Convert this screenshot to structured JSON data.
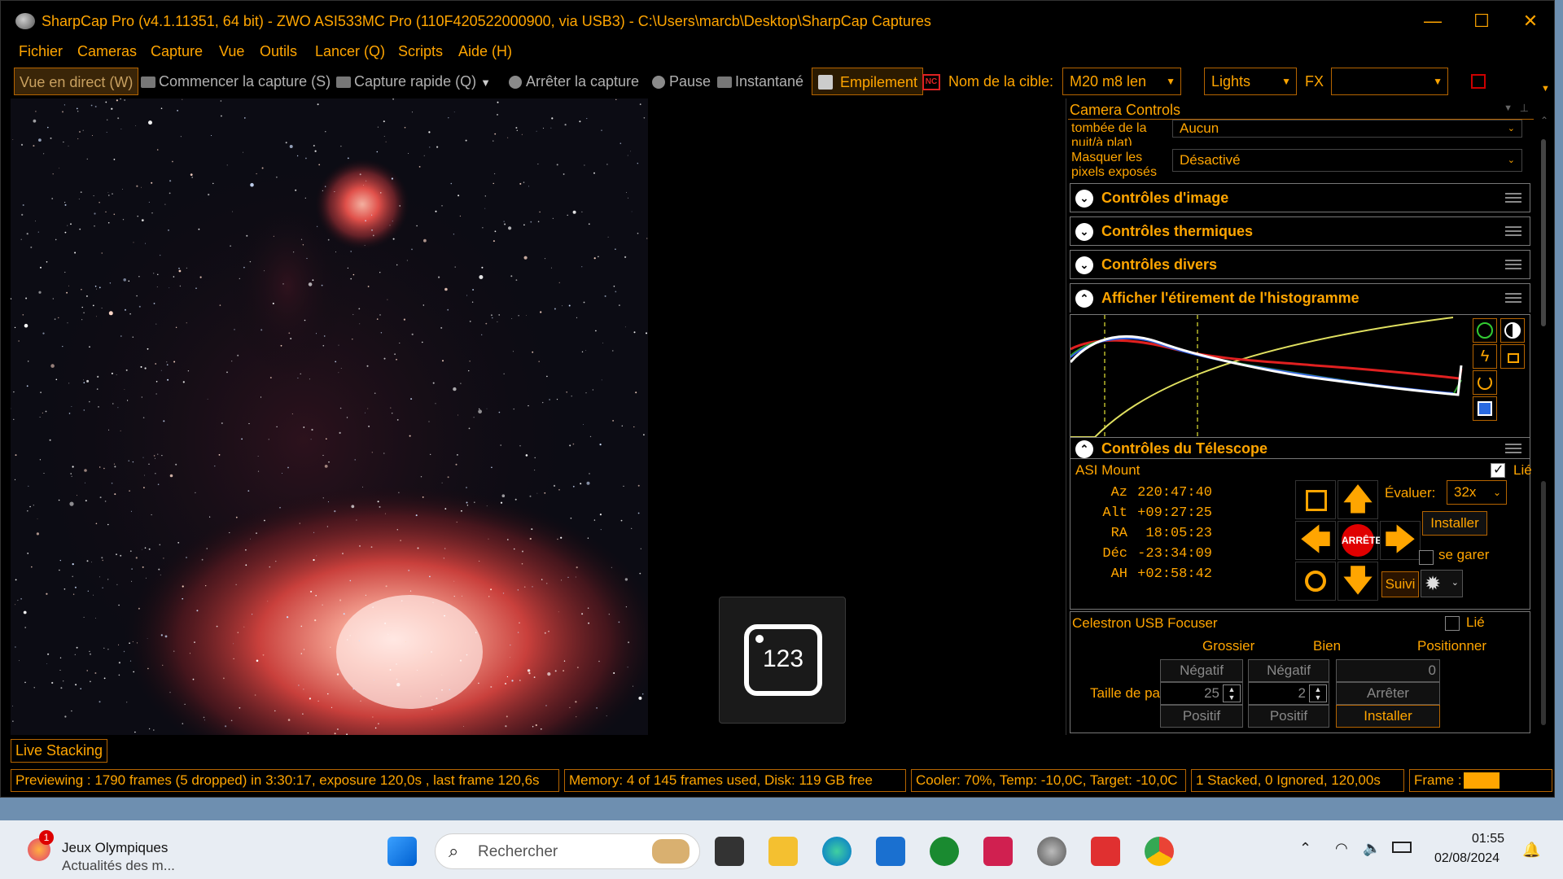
{
  "window": {
    "title": "SharpCap Pro (v4.1.11351, 64 bit) - ZWO ASI533MC Pro (110F420522000900, via USB3) - C:\\Users\\marcb\\Desktop\\SharpCap Captures",
    "minimize": "—",
    "maximize": "☐",
    "close": "✕"
  },
  "menu": [
    "Fichier",
    "Cameras",
    "Capture",
    "Vue",
    "Outils",
    "Lancer (Q)",
    "Scripts",
    "Aide (H)"
  ],
  "toolbar": {
    "live_view": "Vue en direct (W)",
    "start_capture": "Commencer la capture (S)",
    "quick_capture": "Capture rapide (Q)",
    "stop_capture": "Arrêter la capture",
    "pause": "Pause",
    "snapshot": "Instantané",
    "stacking": "Empilement",
    "target_label": "Nom de la cible:",
    "target_value": "M20 m8 len",
    "frame_type": "Lights",
    "fx_label": "FX",
    "fx_value": ""
  },
  "panel": {
    "header": "Camera Controls",
    "nightfall_label": "tombée de la nuit/à plat)",
    "nightfall_value": "Aucun",
    "mask_label": "Masquer les pixels exposés",
    "mask_value": "Désactivé",
    "groups": {
      "image": "Contrôles d'image",
      "thermal": "Contrôles thermiques",
      "misc": "Contrôles divers",
      "histogram": "Afficher l'étirement de l'histogramme",
      "telescope": "Contrôles du Télescope"
    }
  },
  "telescope": {
    "mount_name": "ASI Mount",
    "linked_label": "Lié",
    "rows": [
      {
        "label": "Az",
        "value": "220:47:40"
      },
      {
        "label": "Alt",
        "value": "+09:27:25"
      },
      {
        "label": "RA",
        "value": "18:05:23"
      },
      {
        "label": "Déc",
        "value": "-23:34:09"
      },
      {
        "label": "AH",
        "value": "+02:58:42"
      }
    ],
    "rate_label": "Évaluer:",
    "rate_value": "32x",
    "install_btn": "Installer",
    "stop_btn": "ARRÊTE",
    "park_label": "se garer",
    "tracking_btn": "Suivi"
  },
  "focuser": {
    "name": "Celestron USB Focuser",
    "linked_label": "Lié",
    "col_coarse": "Grossier",
    "col_fine": "Bien",
    "col_position": "Positionner",
    "negative": "Négatif",
    "positive": "Positif",
    "position_value": "0",
    "step_label": "Taille de pas",
    "coarse_step": "25",
    "fine_step": "2",
    "stop_btn": "Arrêter",
    "install_btn": "Installer"
  },
  "number_tile": "123",
  "live_stacking_tab": "Live Stacking",
  "status": {
    "preview": "Previewing : 1790 frames (5 dropped) in 3:30:17, exposure 120,0s , last frame 120,6s",
    "memory": "Memory: 4 of 145 frames used, Disk: 119 GB free",
    "cooler": "Cooler: 70%, Temp: -10,0C, Target: -10,0C",
    "stacked": "1 Stacked, 0 Ignored, 120,00s",
    "frame_label": "Frame :"
  },
  "taskbar": {
    "news_title": "Jeux Olympiques",
    "news_sub": "Actualités des m...",
    "news_badge": "1",
    "search_placeholder": "Rechercher",
    "time": "01:55",
    "date": "02/08/2024"
  },
  "colors": {
    "accent": "#ffa500",
    "border": "#b56400",
    "stop": "#e00000"
  }
}
